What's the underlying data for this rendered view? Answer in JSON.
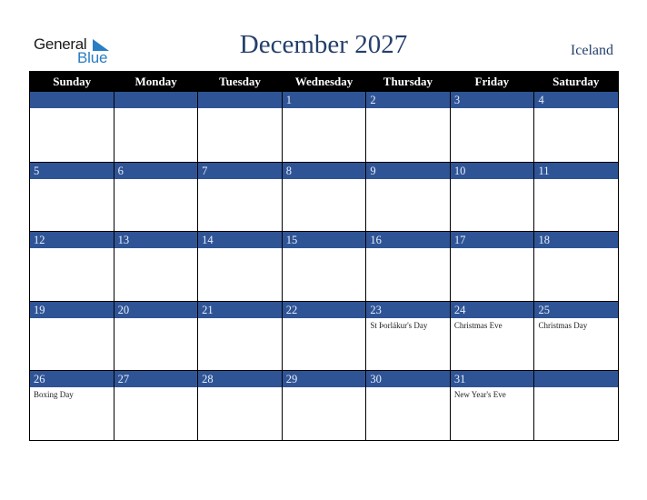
{
  "logo": {
    "line1": "General",
    "line2": "Blue",
    "icon": "triangle-flag-icon"
  },
  "header": {
    "title": "December 2027",
    "country": "Iceland"
  },
  "colors": {
    "band": "#2f5496",
    "title": "#243f6b",
    "header_bg": "#000000",
    "logo_blue": "#2a7ec4"
  },
  "weekdays": [
    "Sunday",
    "Monday",
    "Tuesday",
    "Wednesday",
    "Thursday",
    "Friday",
    "Saturday"
  ],
  "weeks": [
    [
      {
        "day": "",
        "holiday": ""
      },
      {
        "day": "",
        "holiday": ""
      },
      {
        "day": "",
        "holiday": ""
      },
      {
        "day": "1",
        "holiday": ""
      },
      {
        "day": "2",
        "holiday": ""
      },
      {
        "day": "3",
        "holiday": ""
      },
      {
        "day": "4",
        "holiday": ""
      }
    ],
    [
      {
        "day": "5",
        "holiday": ""
      },
      {
        "day": "6",
        "holiday": ""
      },
      {
        "day": "7",
        "holiday": ""
      },
      {
        "day": "8",
        "holiday": ""
      },
      {
        "day": "9",
        "holiday": ""
      },
      {
        "day": "10",
        "holiday": ""
      },
      {
        "day": "11",
        "holiday": ""
      }
    ],
    [
      {
        "day": "12",
        "holiday": ""
      },
      {
        "day": "13",
        "holiday": ""
      },
      {
        "day": "14",
        "holiday": ""
      },
      {
        "day": "15",
        "holiday": ""
      },
      {
        "day": "16",
        "holiday": ""
      },
      {
        "day": "17",
        "holiday": ""
      },
      {
        "day": "18",
        "holiday": ""
      }
    ],
    [
      {
        "day": "19",
        "holiday": ""
      },
      {
        "day": "20",
        "holiday": ""
      },
      {
        "day": "21",
        "holiday": ""
      },
      {
        "day": "22",
        "holiday": ""
      },
      {
        "day": "23",
        "holiday": "St Þorlákur's Day"
      },
      {
        "day": "24",
        "holiday": "Christmas Eve"
      },
      {
        "day": "25",
        "holiday": "Christmas Day"
      }
    ],
    [
      {
        "day": "26",
        "holiday": "Boxing Day"
      },
      {
        "day": "27",
        "holiday": ""
      },
      {
        "day": "28",
        "holiday": ""
      },
      {
        "day": "29",
        "holiday": ""
      },
      {
        "day": "30",
        "holiday": ""
      },
      {
        "day": "31",
        "holiday": "New Year's Eve"
      },
      {
        "day": "",
        "holiday": ""
      }
    ]
  ]
}
